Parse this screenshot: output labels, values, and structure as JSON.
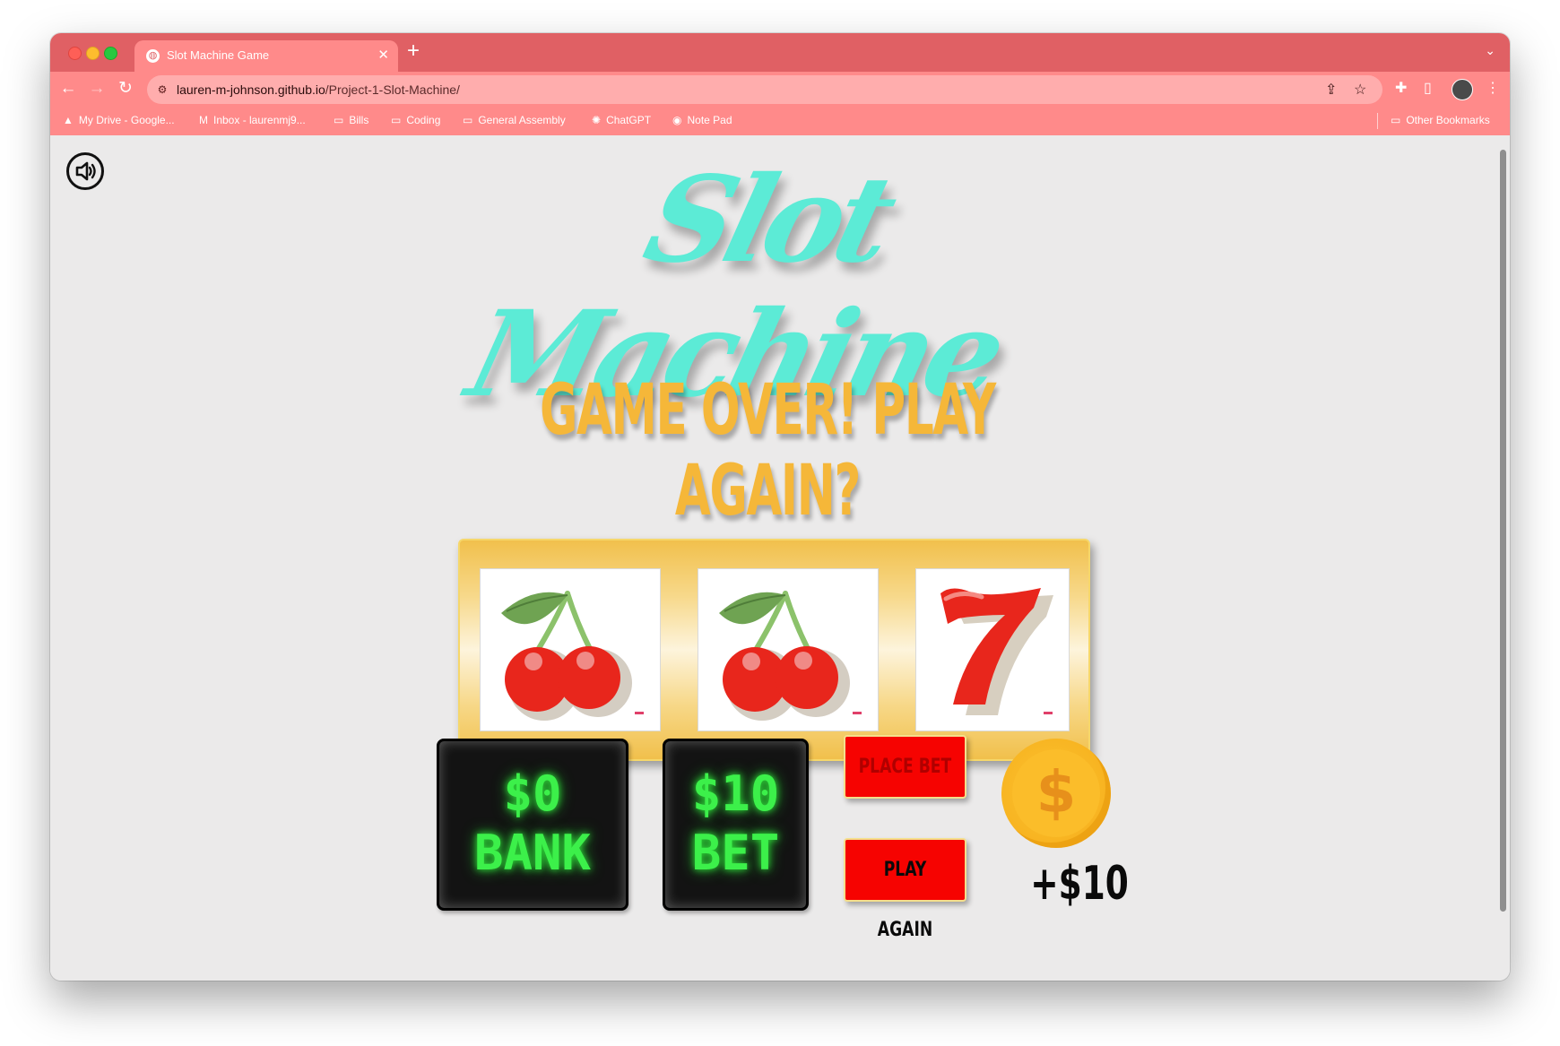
{
  "browser": {
    "tab_title": "Slot Machine Game",
    "url_host": "lauren-m-johnson.github.io",
    "url_path": "/Project-1-Slot-Machine/",
    "bookmarks": [
      {
        "label": "My Drive - Google...",
        "icon": "google-drive-icon"
      },
      {
        "label": "Inbox - laurenmj9...",
        "icon": "gmail-icon"
      },
      {
        "label": "Bills",
        "icon": "folder-icon"
      },
      {
        "label": "Coding",
        "icon": "folder-icon"
      },
      {
        "label": "General Assembly",
        "icon": "folder-icon"
      },
      {
        "label": "ChatGPT",
        "icon": "chatgpt-icon"
      },
      {
        "label": "Note Pad",
        "icon": "globe-icon"
      }
    ],
    "other_bookmarks": "Other Bookmarks"
  },
  "game": {
    "title": "Slot Machine",
    "message": "GAME OVER! PLAY AGAIN?",
    "reels": [
      "cherries",
      "cherries",
      "seven"
    ],
    "bank_value": "$0",
    "bank_label": "BANK",
    "bet_value": "$10",
    "bet_label": "BET",
    "place_bet_label": "PLACE BET",
    "play_again_label": "PLAY AGAIN",
    "coin_symbol": "$",
    "winnings": "+$10"
  },
  "colors": {
    "browser_chrome": "#e06064",
    "title": "#5cebd6",
    "message": "#f5b739",
    "led_green": "#3cf04a",
    "button_red": "#f60301"
  }
}
